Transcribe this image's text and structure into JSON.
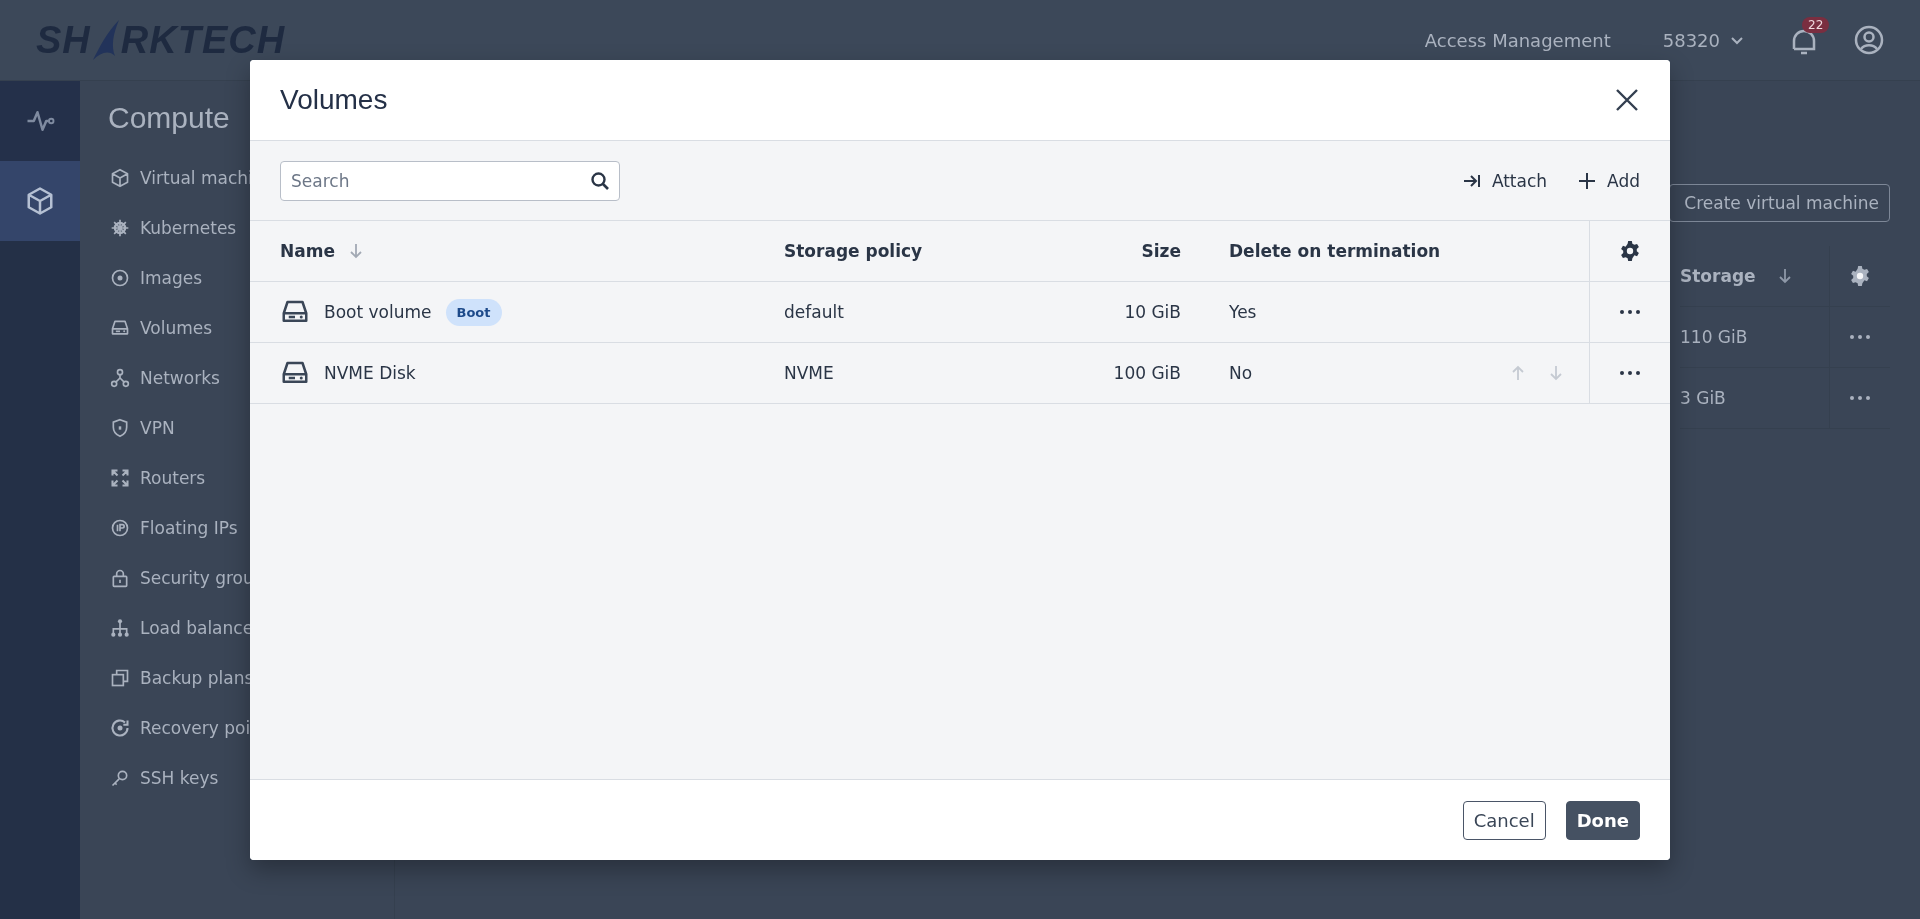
{
  "header": {
    "logo": {
      "left": "SH",
      "right": "RKTECH"
    },
    "links": [
      "Access Management"
    ],
    "account": "58320",
    "notifications": "22"
  },
  "rail": [
    {
      "kind": "pulse",
      "selected": false
    },
    {
      "kind": "cube",
      "selected": true
    }
  ],
  "sidebar": {
    "title": "Compute",
    "items": [
      {
        "label": "Virtual machi"
      },
      {
        "label": "Kubernetes"
      },
      {
        "label": "Images"
      },
      {
        "label": "Volumes"
      },
      {
        "label": "Networks"
      },
      {
        "label": "VPN"
      },
      {
        "label": "Routers"
      },
      {
        "label": "Floating IPs"
      },
      {
        "label": "Security grou"
      },
      {
        "label": "Load balance"
      },
      {
        "label": "Backup plans"
      },
      {
        "label": "Recovery poi"
      },
      {
        "label": "SSH keys"
      }
    ]
  },
  "main": {
    "create_button": "Create virtual machine",
    "table": {
      "column": "Storage",
      "rows": [
        "110 GiB",
        "3 GiB"
      ]
    }
  },
  "dialog": {
    "title": "Volumes",
    "search": {
      "placeholder": "Search"
    },
    "actions": [
      {
        "label": "Attach",
        "kind": "attach"
      },
      {
        "label": "Add",
        "kind": "add"
      }
    ],
    "columns": [
      {
        "label": "Name",
        "sorted": true
      },
      {
        "label": "Storage policy",
        "sorted": false
      },
      {
        "label": "Size",
        "sorted": false
      },
      {
        "label": "Delete on termination",
        "sorted": false
      }
    ],
    "rows": [
      {
        "name": "Boot volume",
        "badge": "Boot",
        "policy": "default",
        "size": "10 GiB",
        "delete": "Yes",
        "hovered": false
      },
      {
        "name": "NVME Disk",
        "policy": "NVME",
        "size": "100 GiB",
        "delete": "No",
        "hovered": true
      }
    ],
    "buttons": [
      {
        "label": "Cancel",
        "kind": "secondary"
      },
      {
        "label": "Done",
        "kind": "primary"
      }
    ]
  }
}
